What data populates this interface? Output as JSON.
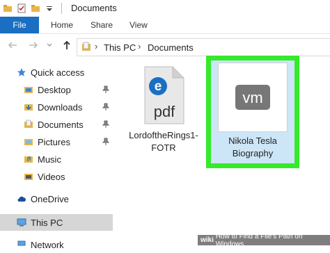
{
  "window": {
    "title": "Documents"
  },
  "ribbon": {
    "tabs": [
      "File",
      "Home",
      "Share",
      "View"
    ]
  },
  "address": {
    "crumbs": [
      "This PC",
      "Documents"
    ]
  },
  "sidebar": {
    "quick_access": "Quick access",
    "items": [
      "Desktop",
      "Downloads",
      "Documents",
      "Pictures",
      "Music",
      "Videos"
    ],
    "onedrive": "OneDrive",
    "this_pc": "This PC",
    "network": "Network"
  },
  "files": [
    {
      "name_line1": "LordoftheRings1-",
      "name_line2": "FOTR",
      "icon": "pdf-edge-icon",
      "icon_text": "pdf"
    },
    {
      "name_line1": "Nikola Tesla",
      "name_line2": "Biography",
      "icon": "vmware-icon",
      "icon_text": "vm"
    }
  ],
  "watermark": {
    "brand": "wiki",
    "text": "How to Find a File's Path on Windows"
  },
  "colors": {
    "accent": "#1a6fc2",
    "highlight": "#35ea2a",
    "selection": "#cde6f7"
  }
}
